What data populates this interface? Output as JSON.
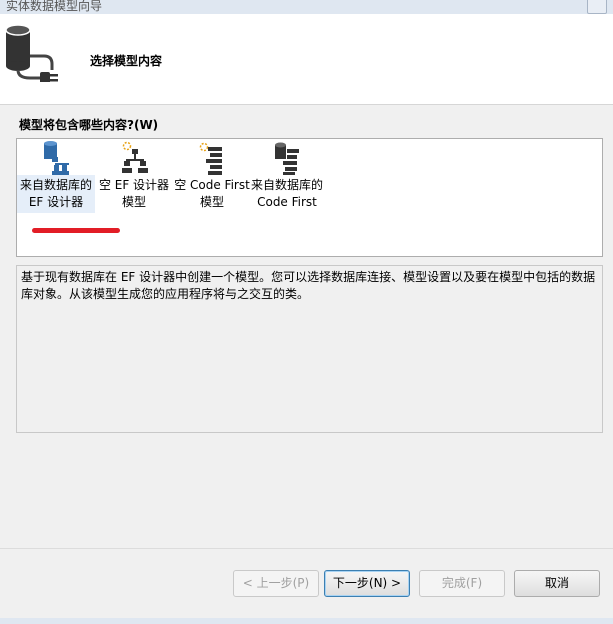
{
  "window": {
    "title": "实体数据模型向导"
  },
  "header": {
    "title": "选择模型内容",
    "icon": "database-plug-icon"
  },
  "question": "模型将包含哪些内容?(W)",
  "options": [
    {
      "label": "来自数据库的 EF 设计器",
      "icon": "database-schema-icon",
      "selected": true
    },
    {
      "label": "空 EF 设计器模型",
      "icon": "empty-model-icon",
      "selected": false
    },
    {
      "label": "空 Code First 模型",
      "icon": "empty-codefirst-icon",
      "selected": false
    },
    {
      "label": "来自数据库的 Code First",
      "icon": "database-codefirst-icon",
      "selected": false
    }
  ],
  "description": "基于现有数据库在 EF 设计器中创建一个模型。您可以选择数据库连接、模型设置以及要在模型中包括的数据库对象。从该模型生成您的应用程序将与之交互的类。",
  "buttons": {
    "prev": "< 上一步(P)",
    "next": "下一步(N) >",
    "finish": "完成(F)",
    "cancel": "取消"
  },
  "colors": {
    "annotation_underline": "#e21d26",
    "selection": "#e5eef9"
  }
}
